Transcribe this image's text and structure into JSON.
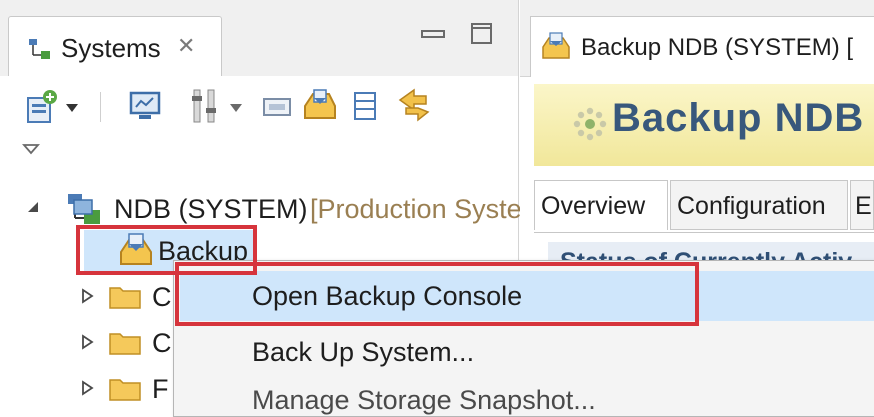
{
  "systems_view": {
    "tab_label": "Systems",
    "tree": {
      "system": {
        "name": "NDB (SYSTEM)",
        "suffix": "[Production Syste"
      },
      "backup": "Backup",
      "folders": [
        {
          "label": "C"
        },
        {
          "label": "C"
        },
        {
          "label": "F"
        }
      ]
    }
  },
  "editor": {
    "tab_label": "Backup NDB (SYSTEM) [",
    "title": "Backup NDB (",
    "subtabs": [
      "Overview",
      "Configuration",
      "E"
    ],
    "section_title": "Status of Currently Activ"
  },
  "context_menu": {
    "items": [
      {
        "label": "Open Backup Console",
        "highlighted": true
      },
      {
        "label": "Back Up System...",
        "highlighted": false
      },
      {
        "label": "Manage Storage Snapshot...",
        "highlighted": false
      }
    ]
  },
  "colors": {
    "highlight_red": "#d6343c",
    "selection_blue": "#cfe6fb",
    "title_blue": "#38587c",
    "header_yellow": "#f1e79a"
  }
}
